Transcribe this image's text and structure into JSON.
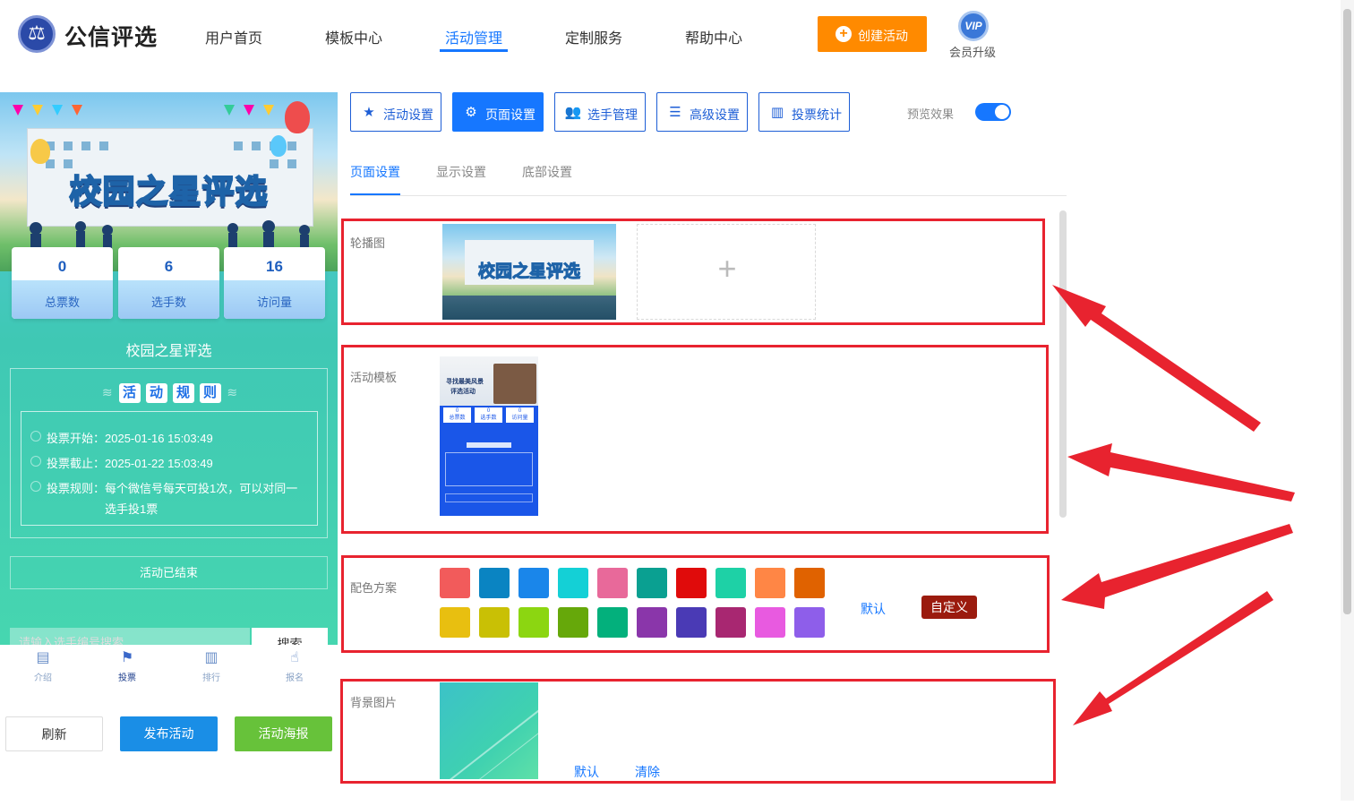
{
  "header": {
    "brand": "公信评选",
    "nav": [
      "用户首页",
      "模板中心",
      "活动管理",
      "定制服务",
      "帮助中心"
    ],
    "create_label": "创建活动",
    "vip_badge": "VIP",
    "vip_label": "会员升级"
  },
  "preview": {
    "banner_title": "校园之星评选",
    "stats": [
      {
        "value": "0",
        "label": "总票数"
      },
      {
        "value": "6",
        "label": "选手数"
      },
      {
        "value": "16",
        "label": "访问量"
      }
    ],
    "title": "校园之星评选",
    "rules_heading": [
      "活",
      "动",
      "规",
      "则"
    ],
    "rules": [
      "投票开始：2025-01-16 15:03:49",
      "投票截止：2025-01-22 15:03:49",
      "投票规则：每个微信号每天可投1次，可以对同一",
      "选手投1票"
    ],
    "ended": "活动已结束",
    "search_placeholder": "请输入选手编号搜索",
    "search_button": "搜索",
    "tabs": [
      "介绍",
      "投票",
      "排行",
      "报名"
    ]
  },
  "actions": {
    "refresh": "刷新",
    "publish": "发布活动",
    "poster": "活动海报"
  },
  "toolbar": [
    "活动设置",
    "页面设置",
    "选手管理",
    "高级设置",
    "投票统计"
  ],
  "preview_toggle_label": "预览效果",
  "subtabs": [
    "页面设置",
    "显示设置",
    "底部设置"
  ],
  "sections": {
    "carousel": "轮播图",
    "template": "活动模板",
    "colors": "配色方案",
    "background": "背景图片"
  },
  "template_thumb": {
    "title_line1": "寻找最美风景",
    "title_line2": "评选活动",
    "stat_labels": [
      "总票数",
      "选手数",
      "访问量"
    ],
    "stat_values": [
      "0",
      "0",
      "0"
    ]
  },
  "color_scheme": {
    "row1": [
      "#f25b5b",
      "#0a84c2",
      "#1a86ea",
      "#14d0d6",
      "#e8699a",
      "#0aa091",
      "#e00b0b",
      "#1ed1a6",
      "#ff8645",
      "#e06200"
    ],
    "row2": [
      "#e8bf10",
      "#c9c005",
      "#8cd611",
      "#66a80a",
      "#03b07c",
      "#8a36aa",
      "#4a3ab5",
      "#a82771",
      "#e85ae0",
      "#8e5eea"
    ],
    "default_label": "默认",
    "custom_label": "自定义"
  },
  "background": {
    "default_label": "默认",
    "clear_label": "清除"
  },
  "colors": {
    "accent": "#1677ff",
    "orange": "#ff8a00",
    "annotation_red": "#e8232f",
    "green": "#67c23a"
  }
}
